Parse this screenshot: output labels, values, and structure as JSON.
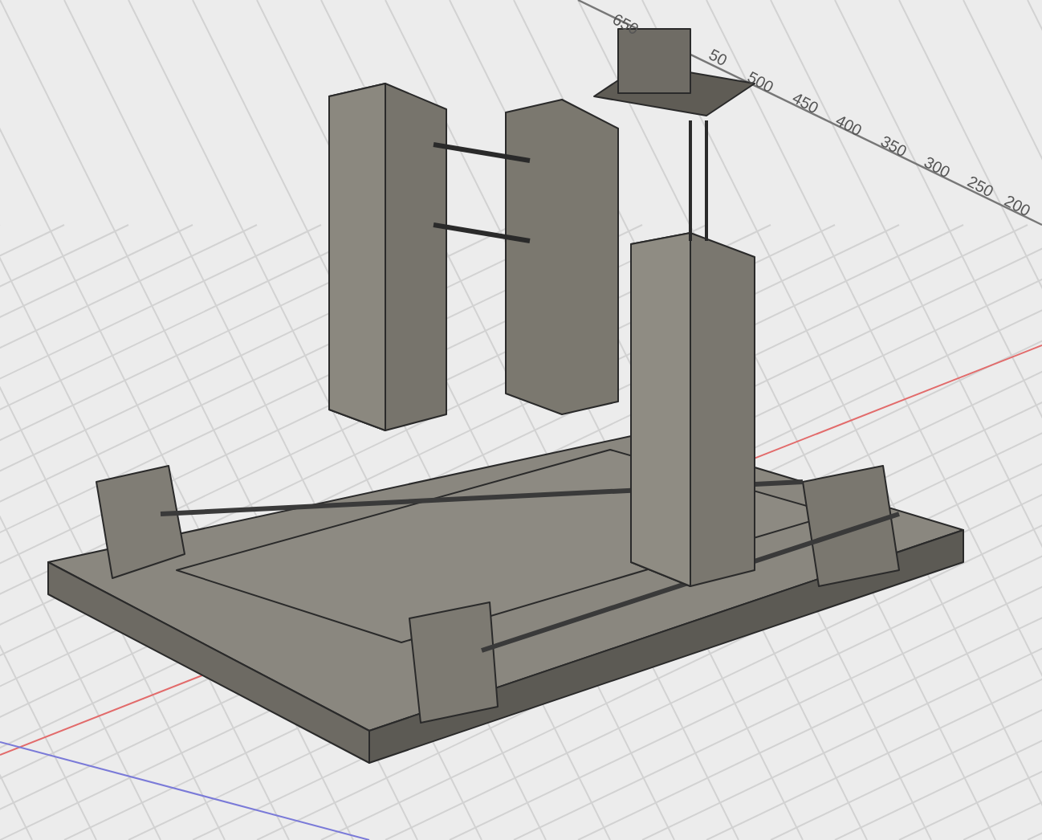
{
  "viewport": {
    "axis_labels": [
      {
        "text": "650"
      },
      {
        "text": "50"
      },
      {
        "text": "500"
      },
      {
        "text": "450"
      },
      {
        "text": "400"
      },
      {
        "text": "350"
      },
      {
        "text": "300"
      },
      {
        "text": "250"
      },
      {
        "text": "200"
      }
    ]
  }
}
